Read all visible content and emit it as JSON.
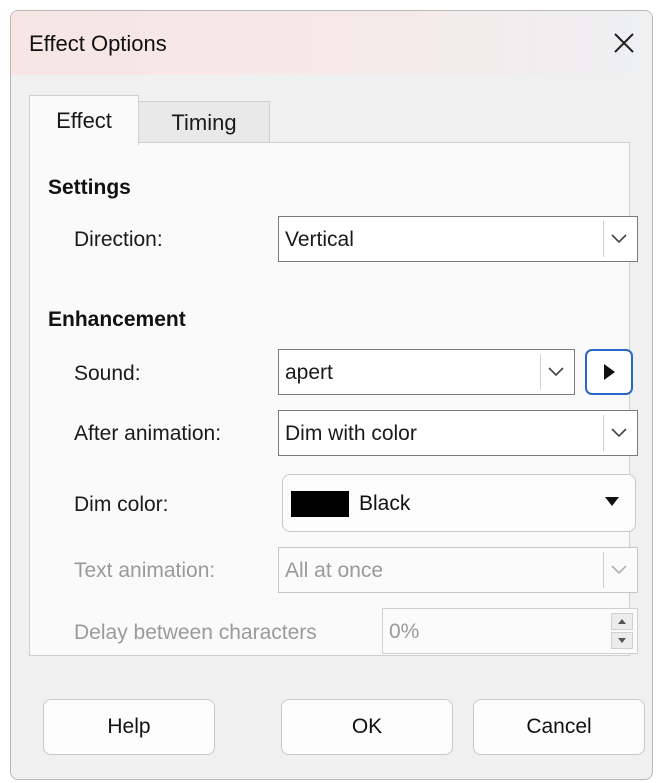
{
  "window": {
    "title": "Effect Options",
    "titlebar_color": "#f6e6e4"
  },
  "tabs": [
    {
      "label": "Effect",
      "active": true
    },
    {
      "label": "Timing",
      "active": false
    }
  ],
  "settings": {
    "heading": "Settings",
    "direction_label": "Direction:",
    "direction_value": "Vertical"
  },
  "enhancement": {
    "heading": "Enhancement",
    "sound_label": "Sound:",
    "sound_value": "apert",
    "after_animation_label": "After animation:",
    "after_animation_value": "Dim with color",
    "dim_color_label": "Dim color:",
    "dim_color_value": "Black",
    "dim_color_swatch": "#000000",
    "text_animation_label": "Text animation:",
    "text_animation_value": "All at once",
    "delay_label": "Delay between characters",
    "delay_value": "0%"
  },
  "buttons": {
    "help": "Help",
    "ok": "OK",
    "cancel": "Cancel"
  },
  "icons": {
    "close": "close-icon",
    "dropdown": "chevron-down-icon",
    "play": "play-icon",
    "dim_dropdown": "caret-down-icon",
    "spin_up": "spin-up-icon",
    "spin_down": "spin-down-icon"
  },
  "colors": {
    "accent": "#2a66c7",
    "disabled_text": "#9a9a9a"
  }
}
